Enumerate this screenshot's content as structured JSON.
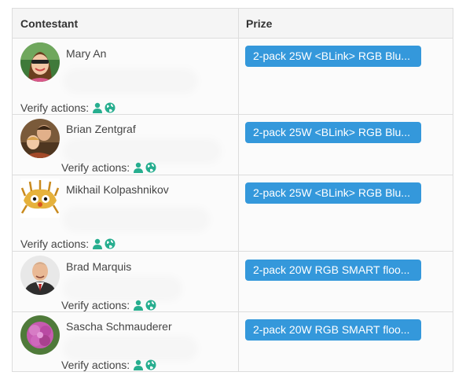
{
  "table": {
    "headers": {
      "contestant": "Contestant",
      "prize": "Prize"
    },
    "rows": [
      {
        "name": "Mary An",
        "verify_label": "Verify actions:",
        "prize": "2-pack 25W <BLink> RGB Blu..."
      },
      {
        "name": "Brian Zentgraf",
        "verify_label": "Verify actions:",
        "prize": "2-pack 25W <BLink> RGB Blu..."
      },
      {
        "name": "Mikhail Kolpashnikov",
        "verify_label": "Verify actions:",
        "prize": "2-pack 25W <BLink> RGB Blu..."
      },
      {
        "name": "Brad Marquis",
        "verify_label": "Verify actions:",
        "prize": "2-pack 20W RGB SMART floo..."
      },
      {
        "name": "Sascha Schmauderer",
        "verify_label": "Verify actions:",
        "prize": "2-pack 20W RGB SMART floo..."
      }
    ],
    "verify_icons": [
      "user-icon",
      "globe-icon"
    ]
  },
  "colors": {
    "prize_button": "#3498db",
    "verify_icon": "#27ae8f",
    "border": "#dddddd",
    "text": "#444444"
  }
}
